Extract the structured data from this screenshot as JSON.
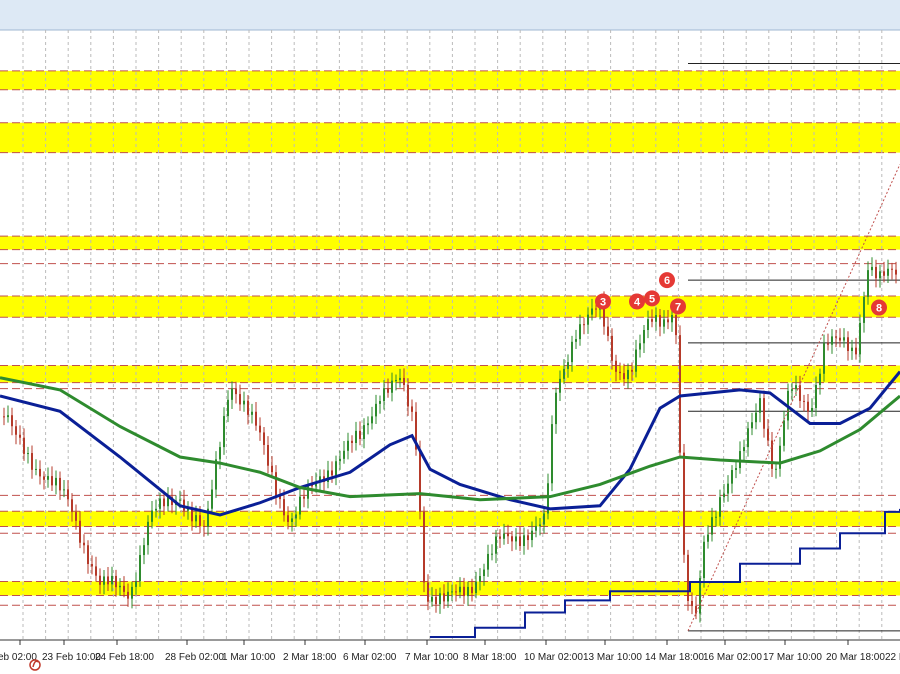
{
  "chart_data": {
    "type": "line",
    "subtype": "candlestick",
    "x_tick_labels": [
      "eb 02:00",
      "23 Feb 10:00",
      "24 Feb 18:00",
      "28 Feb 02:00",
      "1 Mar 10:00",
      "2 Mar 18:00",
      "6 Mar 02:00",
      "7 Mar 10:00",
      "8 Mar 18:00",
      "10 Mar 02:00",
      "13 Mar 10:00",
      "14 Mar 18:00",
      "16 Mar 02:00",
      "17 Mar 10:00",
      "20 Mar 18:00",
      "22 M"
    ],
    "grid": "vertical dashed",
    "price_range": [
      0,
      100
    ],
    "support_resistance_zones": [
      {
        "from": 93.3,
        "to": 90.2
      },
      {
        "from": 84.8,
        "to": 79.9
      },
      {
        "from": 66.2,
        "to": 64.0
      },
      {
        "from": 56.4,
        "to": 52.9
      },
      {
        "from": 45.0,
        "to": 42.2
      },
      {
        "from": 21.1,
        "to": 18.6
      },
      {
        "from": 9.6,
        "to": 7.3
      }
    ],
    "markers": [
      {
        "label": "3",
        "x_index": 603,
        "price": 55.5
      },
      {
        "label": "4",
        "x_index": 637,
        "price": 55.5
      },
      {
        "label": "5",
        "x_index": 652,
        "price": 56.0
      },
      {
        "label": "6",
        "x_index": 667,
        "price": 59.0
      },
      {
        "label": "7",
        "x_index": 678,
        "price": 54.7
      },
      {
        "label": "8",
        "x_index": 879,
        "price": 54.5
      }
    ],
    "series": [
      {
        "type": "line",
        "color": "#0a1f96",
        "values": [
          [
            0,
            40.0
          ],
          [
            60,
            37.5
          ],
          [
            120,
            30.0
          ],
          [
            180,
            22.0
          ],
          [
            220,
            20.5
          ],
          [
            260,
            22.5
          ],
          [
            300,
            25.0
          ],
          [
            350,
            27.5
          ],
          [
            390,
            32.0
          ],
          [
            412,
            33.5
          ],
          [
            430,
            28.0
          ],
          [
            460,
            25.5
          ],
          [
            510,
            23.0
          ],
          [
            550,
            21.5
          ],
          [
            600,
            22.0
          ],
          [
            630,
            28.0
          ],
          [
            660,
            38.0
          ],
          [
            680,
            40.0
          ],
          [
            740,
            41.0
          ],
          [
            770,
            40.5
          ],
          [
            790,
            38.0
          ],
          [
            810,
            35.5
          ],
          [
            840,
            35.5
          ],
          [
            870,
            38.0
          ],
          [
            900,
            44.0
          ]
        ]
      },
      {
        "type": "line",
        "color": "#2e8b2e",
        "values": [
          [
            0,
            43.0
          ],
          [
            60,
            41.0
          ],
          [
            120,
            35.0
          ],
          [
            180,
            30.0
          ],
          [
            220,
            29.0
          ],
          [
            260,
            27.5
          ],
          [
            300,
            25.0
          ],
          [
            350,
            23.5
          ],
          [
            420,
            24.0
          ],
          [
            480,
            23.0
          ],
          [
            550,
            23.5
          ],
          [
            600,
            25.5
          ],
          [
            650,
            28.5
          ],
          [
            680,
            30.0
          ],
          [
            720,
            29.5
          ],
          [
            780,
            29.0
          ],
          [
            820,
            31.0
          ],
          [
            860,
            34.5
          ],
          [
            900,
            40.0
          ]
        ]
      },
      {
        "type": "line",
        "color": "#0a1f96",
        "kind": "step",
        "values": [
          [
            430,
            0.5
          ],
          [
            475,
            2.0
          ],
          [
            525,
            4.5
          ],
          [
            565,
            6.5
          ],
          [
            610,
            8.0
          ],
          [
            690,
            9.5
          ],
          [
            740,
            12.5
          ],
          [
            800,
            15.0
          ],
          [
            840,
            17.5
          ],
          [
            885,
            21.0
          ],
          [
            900,
            21.5
          ]
        ]
      }
    ]
  }
}
